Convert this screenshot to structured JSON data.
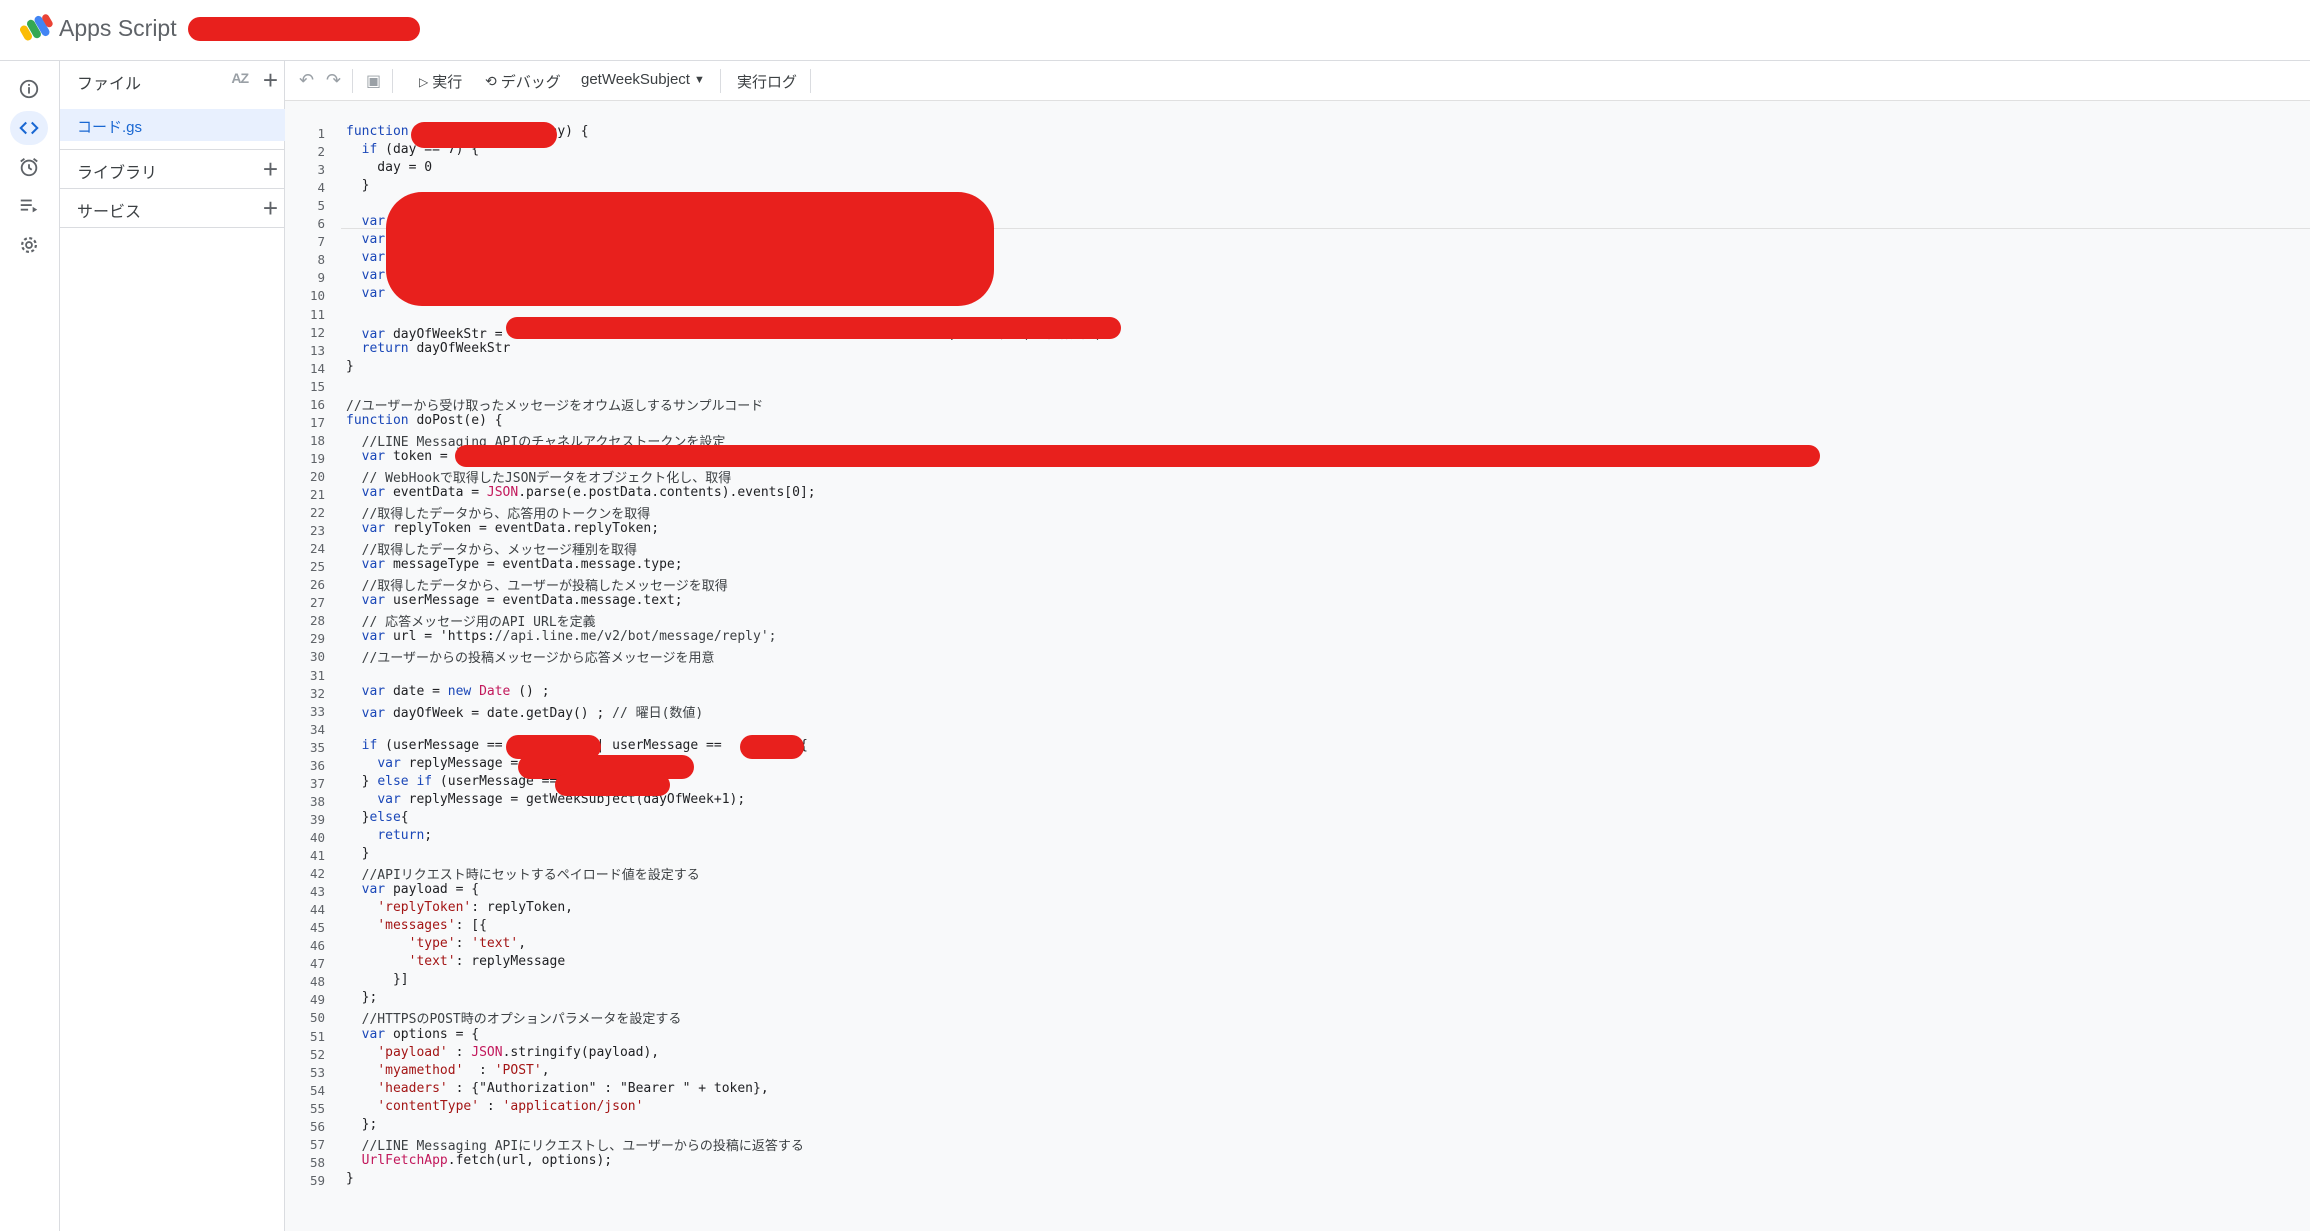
{
  "app": {
    "title": "Apps Script"
  },
  "sidebar": {
    "files_label": "ファイル",
    "sort_label": "AZ",
    "add_label": "+",
    "file_item": "コード.gs",
    "library_label": "ライブラリ",
    "service_label": "サービス"
  },
  "toolbar": {
    "undo": "↶",
    "redo": "↷",
    "save": "▣",
    "run_label": "実行",
    "debug_label": "デバッグ",
    "function_select": "getWeekSubject",
    "log_label": "実行ログ"
  },
  "colors": {
    "accent": "#1967d2",
    "active_bg": "#e8f0fe",
    "redaction": "#e8201d",
    "editor_bg": "#f8f9fa"
  },
  "code": {
    "line_numbers": [
      "1",
      "2",
      "3",
      "4",
      "5",
      "6",
      "7",
      "8",
      "9",
      "10",
      "11",
      "12",
      "13",
      "14",
      "15",
      "16",
      "17",
      "18",
      "19",
      "20",
      "21",
      "22",
      "23",
      "24",
      "25",
      "26",
      "27",
      "28",
      "29",
      "30",
      "31",
      "32",
      "33",
      "34",
      "35",
      "36",
      "37",
      "38",
      "39",
      "40",
      "41",
      "42",
      "43",
      "44",
      "45",
      "46",
      "47",
      "48",
      "49",
      "50",
      "51",
      "52",
      "53",
      "54",
      "55",
      "56",
      "57",
      "58",
      "59"
    ],
    "lines": [
      "function                (day) {",
      "  if (day == 7) {",
      "    day = 0",
      "  }",
      "",
      "  var",
      "  var",
      "  var",
      "  var",
      "  var",
      "",
      "  var dayOfWeekStr =                                                         ;  // 曜日(日本語表記)",
      "  return dayOfWeekStr",
      "}",
      "",
      "//ユーザーから受け取ったメッセージをオウム返しするサンプルコード",
      "function doPost(e) {",
      "  //LINE Messaging APIのチャネルアクセストークンを設定",
      "  var token =",
      "  // WebHookで取得したJSONデータをオブジェクト化し、取得",
      "  var eventData = JSON.parse(e.postData.contents).events[0];",
      "  //取得したデータから、応答用のトークンを取得",
      "  var replyToken = eventData.replyToken;",
      "  //取得したデータから、メッセージ種別を取得",
      "  var messageType = eventData.message.type;",
      "  //取得したデータから、ユーザーが投稿したメッセージを取得",
      "  var userMessage = eventData.message.text;",
      "  // 応答メッセージ用のAPI URLを定義",
      "  var url = 'https://api.line.me/v2/bot/message/reply';",
      "  //ユーザーからの投稿メッセージから応答メッセージを用意",
      "",
      "  var date = new Date () ;",
      "  var dayOfWeek = date.getDay() ; // 曜日(数値)",
      "",
      "  if (userMessage ==           || userMessage ==        ) {",
      "    var replyMessage =",
      "  } else if (userMessage ==",
      "    var replyMessage = getWeekSubject(dayOfWeek+1);",
      "  }else{",
      "    return;",
      "  }",
      "  //APIリクエスト時にセットするペイロード値を設定する",
      "  var payload = {",
      "    'replyToken': replyToken,",
      "    'messages': [{",
      "        'type': 'text',",
      "        'text': replyMessage",
      "      }]",
      "  };",
      "  //HTTPSのPOST時のオプションパラメータを設定する",
      "  var options = {",
      "    'payload' : JSON.stringify(payload),",
      "    'myamethod'  : 'POST',",
      "    'headers' : {\"Authorization\" : \"Bearer \" + token},",
      "    'contentType' : 'application/json'",
      "  };",
      "  //LINE Messaging APIにリクエストし、ユーザーからの投稿に返答する",
      "  UrlFetchApp.fetch(url, options);",
      "}"
    ]
  }
}
